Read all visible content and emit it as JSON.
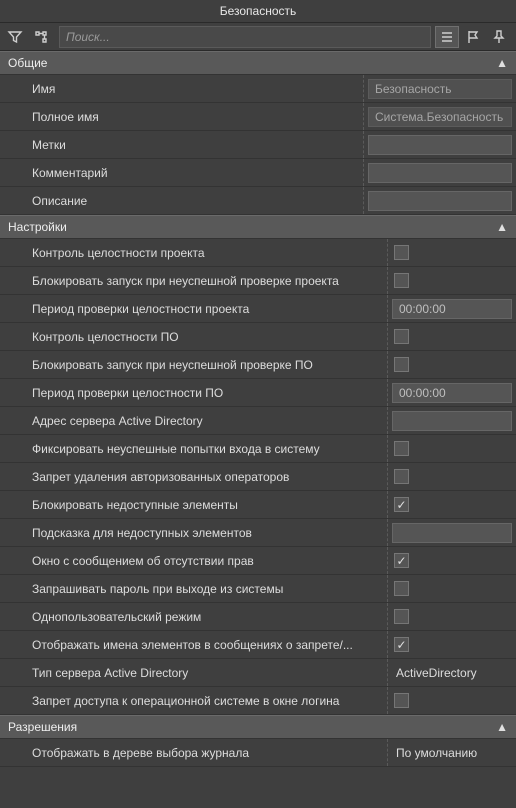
{
  "title": "Безопасность",
  "search": {
    "placeholder": "Поиск..."
  },
  "sections": {
    "general": {
      "title": "Общие",
      "rows": [
        {
          "label": "Имя",
          "value": "Безопасность",
          "kind": "readonly"
        },
        {
          "label": "Полное имя",
          "value": "Система.Безопасность",
          "kind": "readonly"
        },
        {
          "label": "Метки",
          "value": "",
          "kind": "input"
        },
        {
          "label": "Комментарий",
          "value": "",
          "kind": "input"
        },
        {
          "label": "Описание",
          "value": "",
          "kind": "input"
        }
      ]
    },
    "settings": {
      "title": "Настройки",
      "rows": [
        {
          "label": "Контроль целостности проекта",
          "kind": "checkbox",
          "checked": false
        },
        {
          "label": "Блокировать запуск при неуспешной проверке проекта",
          "kind": "checkbox",
          "checked": false
        },
        {
          "label": "Период проверки целостности проекта",
          "kind": "input",
          "value": "00:00:00"
        },
        {
          "label": "Контроль целостности ПО",
          "kind": "checkbox",
          "checked": false
        },
        {
          "label": "Блокировать запуск при неуспешной проверке ПО",
          "kind": "checkbox",
          "checked": false
        },
        {
          "label": "Период проверки целостности ПО",
          "kind": "input",
          "value": "00:00:00"
        },
        {
          "label": "Адрес сервера Active Directory",
          "kind": "input",
          "value": ""
        },
        {
          "label": "Фиксировать неуспешные попытки входа в систему",
          "kind": "checkbox",
          "checked": false
        },
        {
          "label": "Запрет удаления авторизованных операторов",
          "kind": "checkbox",
          "checked": false
        },
        {
          "label": "Блокировать недоступные элементы",
          "kind": "checkbox",
          "checked": true
        },
        {
          "label": "Подсказка для недоступных элементов",
          "kind": "input",
          "value": ""
        },
        {
          "label": "Окно с сообщением об отсутствии прав",
          "kind": "checkbox",
          "checked": true
        },
        {
          "label": "Запрашивать пароль при выходе из системы",
          "kind": "checkbox",
          "checked": false
        },
        {
          "label": "Однопользовательский режим",
          "kind": "checkbox",
          "checked": false
        },
        {
          "label": "Отображать имена элементов в сообщениях о запрете/...",
          "kind": "checkbox",
          "checked": true
        },
        {
          "label": "Тип сервера Active Directory",
          "kind": "text",
          "value": "ActiveDirectory"
        },
        {
          "label": "Запрет доступа к операционной системе в окне логина",
          "kind": "checkbox",
          "checked": false
        }
      ]
    },
    "permissions": {
      "title": "Разрешения",
      "rows": [
        {
          "label": "Отображать в дереве выбора журнала",
          "kind": "text",
          "value": "По умолчанию"
        }
      ]
    }
  }
}
